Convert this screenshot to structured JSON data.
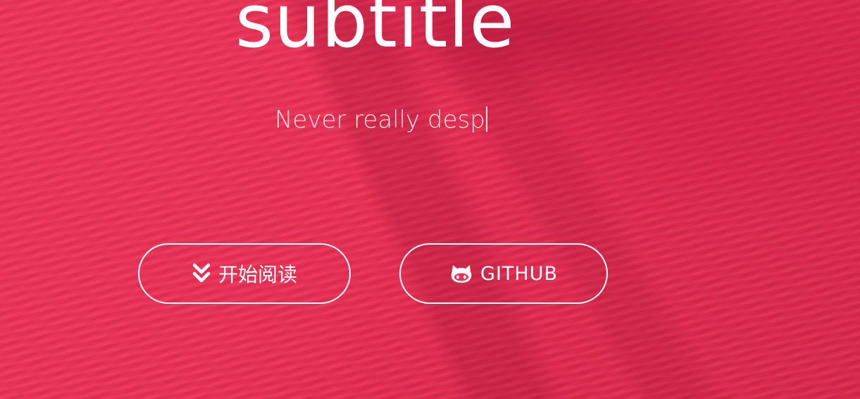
{
  "hero": {
    "title": "subtitle",
    "typed_text": "Never really desp"
  },
  "buttons": {
    "read": {
      "label": "开始阅读",
      "icon": "double-chevron-down-icon"
    },
    "github": {
      "label": "GITHUB",
      "icon": "github-octocat-icon"
    }
  },
  "colors": {
    "background": "#ec2f55",
    "text": "#ffffff",
    "button_border": "#ffffff"
  }
}
